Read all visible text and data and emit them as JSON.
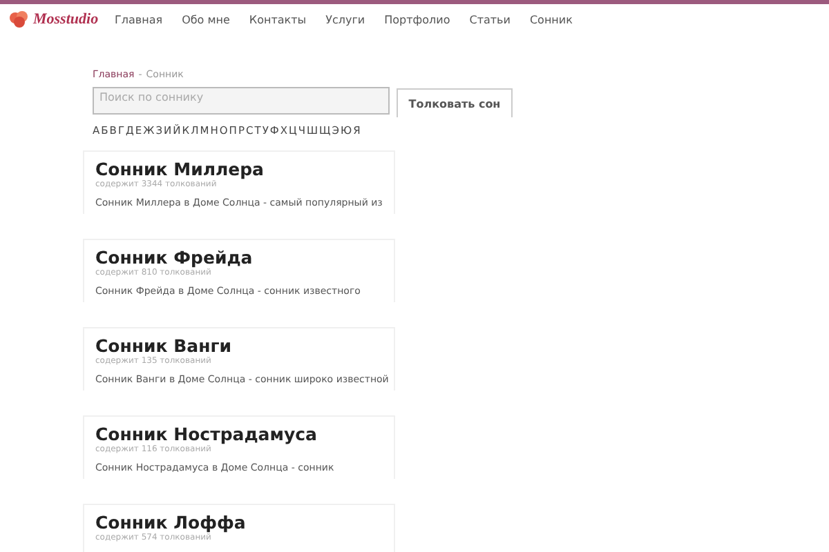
{
  "header": {
    "logo": "Mosstudio",
    "nav": [
      {
        "label": "Главная"
      },
      {
        "label": "Обо мне"
      },
      {
        "label": "Контакты"
      },
      {
        "label": "Услуги"
      },
      {
        "label": "Портфолио"
      },
      {
        "label": "Статьи"
      },
      {
        "label": "Сонник"
      }
    ]
  },
  "breadcrumb": [
    "Главная",
    "Сонник"
  ],
  "breadcrumb_separator": "-",
  "search": {
    "placeholder": "Поиск по соннику",
    "button": "Толковать сон"
  },
  "alphabet": [
    "А",
    "Б",
    "В",
    "Г",
    "Д",
    "Е",
    "Ж",
    "З",
    "И",
    "Й",
    "К",
    "Л",
    "М",
    "Н",
    "О",
    "П",
    "Р",
    "С",
    "Т",
    "У",
    "Ф",
    "Х",
    "Ц",
    "Ч",
    "Ш",
    "Щ",
    "Э",
    "Ю",
    "Я"
  ],
  "dream_books": [
    {
      "title": "Сонник Миллера",
      "count": "содержит 3344 толкований",
      "description": "Сонник Миллера в Доме Солнца - самый популярный из"
    },
    {
      "title": "Сонник Фрейда",
      "count": "содержит 810 толкований",
      "description": "Сонник Фрейда в Доме Солнца - сонник известного"
    },
    {
      "title": "Сонник Ванги",
      "count": "содержит 135 толкований",
      "description": "Сонник Ванги в Доме Солнца - сонник широко известной"
    },
    {
      "title": "Сонник Нострадамуса",
      "count": "содержит 116 толкований",
      "description": "Сонник Нострадамуса в Доме Солнца - сонник"
    },
    {
      "title": "Сонник Лоффа",
      "count": "содержит 574 толкований"
    }
  ]
}
